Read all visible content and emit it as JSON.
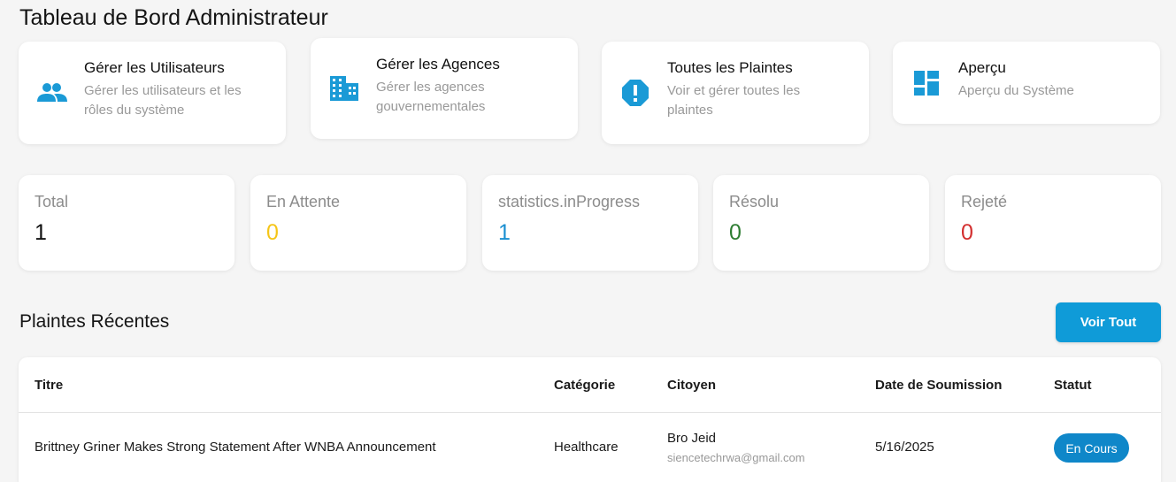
{
  "page": {
    "title": "Tableau de Bord Administrateur"
  },
  "actions": [
    {
      "icon": "people-icon",
      "title": "Gérer les Utilisateurs",
      "description": "Gérer les utilisateurs et les rôles du système"
    },
    {
      "icon": "building-icon",
      "title": "Gérer les Agences",
      "description": "Gérer les agences gouvernementales"
    },
    {
      "icon": "alert-icon",
      "title": "Toutes les Plaintes",
      "description": "Voir et gérer toutes les plaintes"
    },
    {
      "icon": "dashboard-icon",
      "title": "Aperçu",
      "description": "Aperçu du Système"
    }
  ],
  "stats": [
    {
      "label": "Total",
      "value": "1",
      "color": "#111111"
    },
    {
      "label": "En Attente",
      "value": "0",
      "color": "#f5c518"
    },
    {
      "label": "statistics.inProgress",
      "value": "1",
      "color": "#1a8fd1"
    },
    {
      "label": "Résolu",
      "value": "0",
      "color": "#2e7d32"
    },
    {
      "label": "Rejeté",
      "value": "0",
      "color": "#d32f2f"
    }
  ],
  "recent": {
    "title": "Plaintes Récentes",
    "view_all_label": "Voir Tout",
    "columns": [
      "Titre",
      "Catégorie",
      "Citoyen",
      "Date de Soumission",
      "Statut"
    ],
    "rows": [
      {
        "title": "Brittney Griner Makes Strong Statement After WNBA Announcement",
        "category": "Healthcare",
        "citizen_name": "Bro Jeid",
        "citizen_email": "siencetechrwa@gmail.com",
        "date": "5/16/2025",
        "status": "En Cours"
      }
    ]
  },
  "colors": {
    "accent": "#0f9bd8",
    "icon": "#1a9ad6",
    "badge": "#0f87c9",
    "background": "#f5f5f5"
  }
}
